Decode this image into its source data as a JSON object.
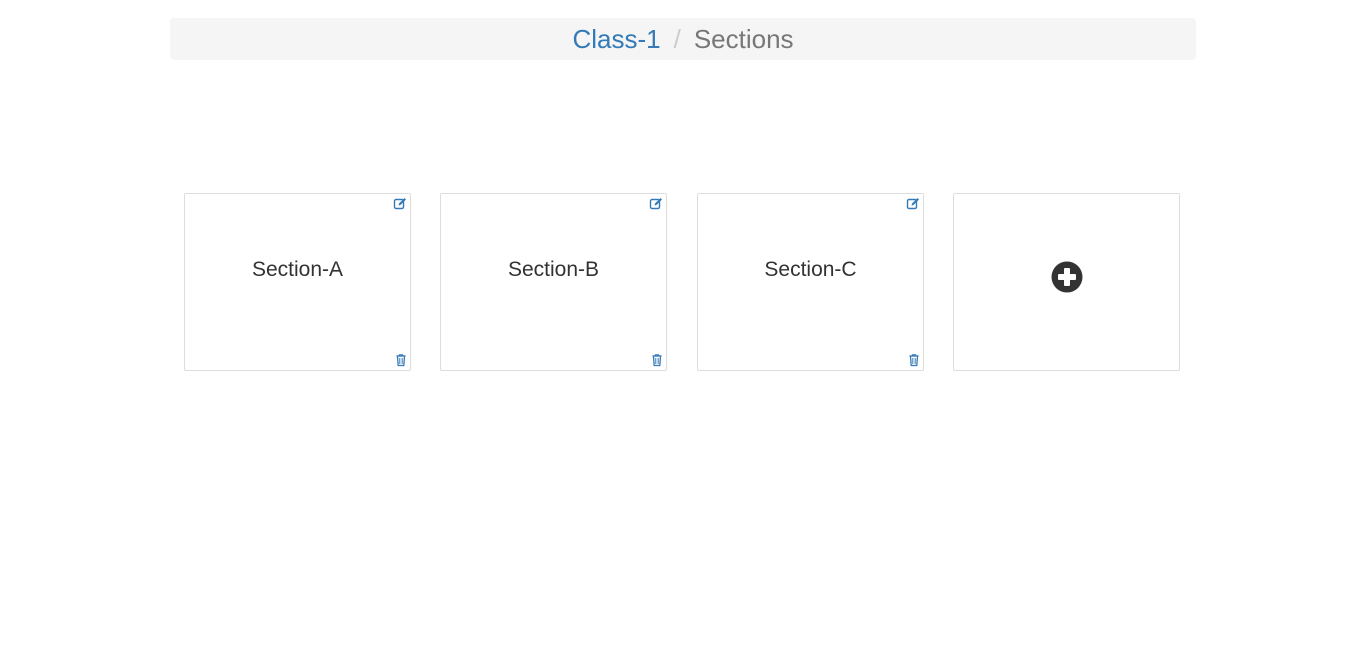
{
  "breadcrumb": {
    "parent": "Class-1",
    "separator": "/",
    "current": "Sections"
  },
  "sections": [
    {
      "name": "Section-A"
    },
    {
      "name": "Section-B"
    },
    {
      "name": "Section-C"
    }
  ],
  "icons": {
    "edit": "edit-icon",
    "delete": "trash-icon",
    "add": "plus-circle-icon"
  },
  "colors": {
    "link": "#337ab7",
    "muted": "#777777",
    "breadcrumb_bg": "#f5f5f5",
    "card_border": "#dddddd",
    "add_icon": "#333333"
  }
}
